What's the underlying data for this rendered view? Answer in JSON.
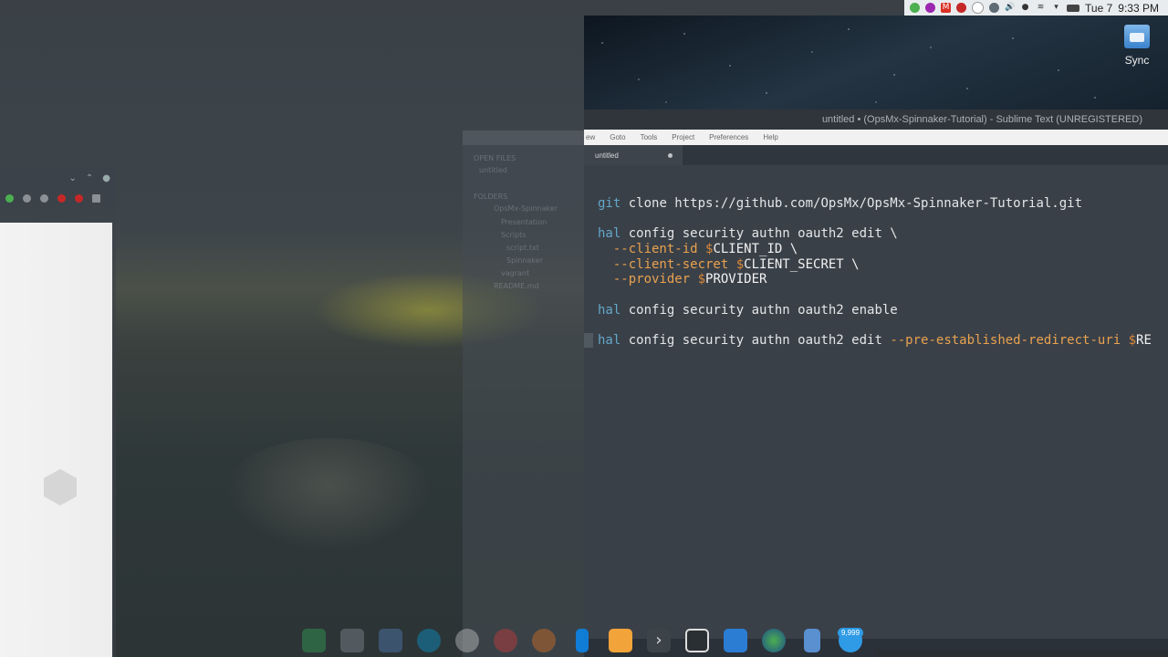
{
  "top_panel": {
    "day": "Tue 7",
    "time": "9:33 PM",
    "tray_icons": [
      "network-tool-icon",
      "messenger-icon",
      "gmail-icon",
      "record-icon",
      "notification-icon",
      "weather-icon",
      "volume-icon",
      "microphone-icon",
      "wifi-icon",
      "dropdown-icon",
      "battery-icon"
    ]
  },
  "desktop": {
    "icon_label": "Sync"
  },
  "sublime": {
    "title": "untitled • (OpsMx-Spinnaker-Tutorial) - Sublime Text (UNREGISTERED)",
    "menu": [
      "ew",
      "Goto",
      "Tools",
      "Project",
      "Preferences",
      "Help"
    ],
    "tab_label": "untitled",
    "sidebar_ghost": [
      "OPEN FILES",
      "untitled",
      "FOLDERS",
      "OpsMx-Spinnaker",
      "Presentation",
      "Scripts",
      "script.txt",
      "Spinnaker",
      "vagrant",
      "README.md"
    ],
    "code": {
      "line1": {
        "cmd": "git",
        "rest": " clone https://github.com/OpsMx/OpsMx-Spinnaker-Tutorial.git"
      },
      "line2": {
        "cmd": "hal",
        "rest": " config security authn oauth2 edit \\"
      },
      "line3": {
        "flag": "  --client-id",
        "dollar": " $",
        "var": "CLIENT_ID \\"
      },
      "line4": {
        "flag": "  --client-secret",
        "dollar": " $",
        "var": "CLIENT_SECRET \\"
      },
      "line5": {
        "flag": "  --provider",
        "dollar": " $",
        "var": "PROVIDER"
      },
      "line6": {
        "cmd": "hal",
        "rest": " config security authn oauth2 enable"
      },
      "line7": {
        "cmd": "hal",
        "rest": " config security authn oauth2 edit ",
        "flag": "--pre-established-redirect-uri",
        "dollar": " $",
        "var": "RE"
      }
    }
  },
  "dock": {
    "items": [
      "manjaro-icon",
      "files-icon",
      "folder-icon",
      "skype-icon",
      "chrome-icon",
      "vivaldi-icon",
      "firefox-icon",
      "vscode-icon",
      "sublime-icon",
      "terminal-icon",
      "sidebar-icon",
      "word-icon",
      "globe-icon",
      "transfer-icon",
      "telegram-icon"
    ],
    "badge": "9,999"
  },
  "colors": {
    "editor_bg": "#3a4048",
    "keyword": "#64a7c9",
    "flag": "#e9a24f",
    "panel_bg": "#e9ecee"
  }
}
